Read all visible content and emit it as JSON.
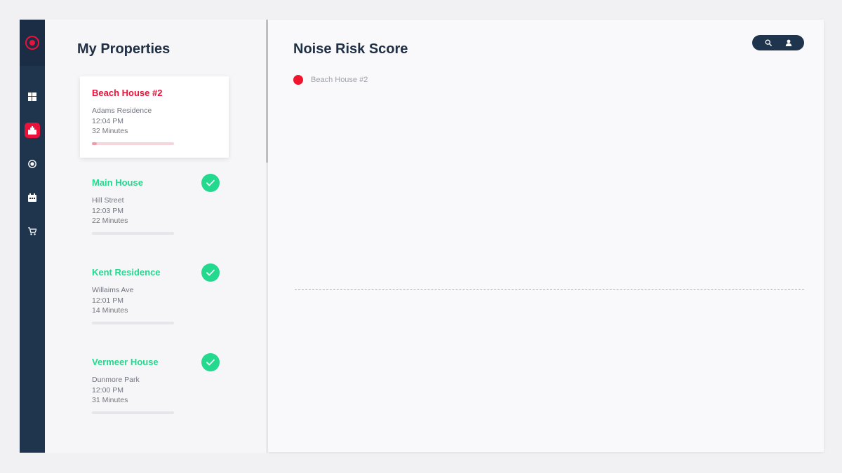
{
  "colors": {
    "sidebar": "#1f344d",
    "accent_red": "#e8123a",
    "success_green": "#23d98e",
    "heading": "#1f2f44"
  },
  "sidebar": {
    "logo": "target-logo-icon",
    "items": [
      {
        "icon": "dashboard-icon",
        "active": false
      },
      {
        "icon": "properties-icon",
        "active": true
      },
      {
        "icon": "record-icon",
        "active": false
      },
      {
        "icon": "calendar-icon",
        "active": false
      },
      {
        "icon": "cart-icon",
        "active": false
      }
    ]
  },
  "properties": {
    "title": "My Properties",
    "items": [
      {
        "name": "Beach House #2",
        "address": "Adams Residence",
        "time": "12:04 PM",
        "duration": "32 Minutes",
        "status": "alert",
        "progress": 0.06
      },
      {
        "name": "Main House",
        "address": "Hill Street",
        "time": "12:03 PM",
        "duration": "22 Minutes",
        "status": "ok",
        "progress": 0
      },
      {
        "name": "Kent Residence",
        "address": "Willaims Ave",
        "time": "12:01 PM",
        "duration": "14 Minutes",
        "status": "ok",
        "progress": 0
      },
      {
        "name": "Vermeer House",
        "address": "Dunmore Park",
        "time": "12:00 PM",
        "duration": "31 Minutes",
        "status": "ok",
        "progress": 0
      }
    ]
  },
  "main": {
    "title": "Noise Risk Score",
    "legend": {
      "label": "Beach House #2",
      "color": "#f0152d"
    },
    "actions": [
      "search-icon",
      "user-icon"
    ]
  }
}
